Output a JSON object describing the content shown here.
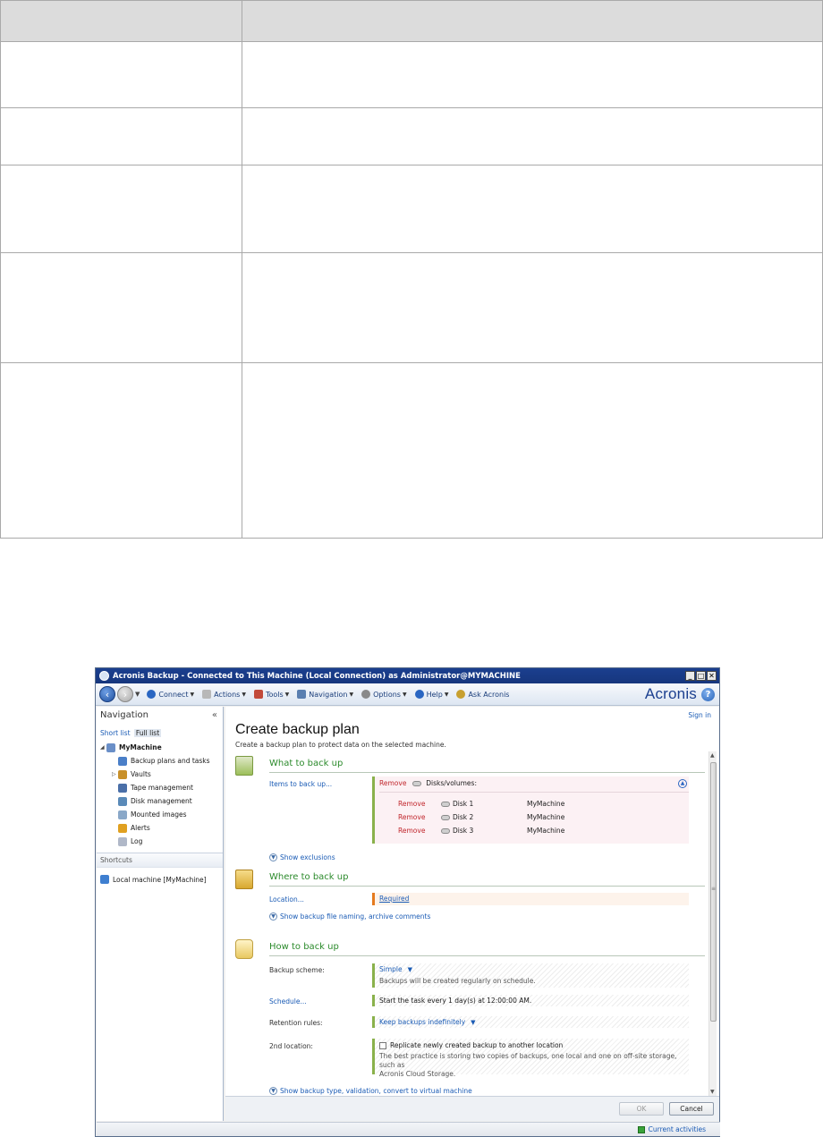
{
  "window": {
    "title": "Acronis Backup - Connected to This Machine (Local Connection) as Administrator@MYMACHINE",
    "brand": "Acronis"
  },
  "menubar": {
    "items": [
      {
        "label": "Connect",
        "icon": "connect-icon",
        "color": "#2a66c2"
      },
      {
        "label": "Actions",
        "icon": "actions-icon",
        "color": "#b8b8b8"
      },
      {
        "label": "Tools",
        "icon": "tools-icon",
        "color": "#c24a3a"
      },
      {
        "label": "Navigation",
        "icon": "navigation-icon",
        "color": "#5a7fb0"
      },
      {
        "label": "Options",
        "icon": "options-icon",
        "color": "#8a8a8a"
      },
      {
        "label": "Help",
        "icon": "help-icon",
        "color": "#2a66c2"
      },
      {
        "label": "Ask Acronis",
        "icon": "ask-acronis-icon",
        "color": "#c8a030"
      }
    ]
  },
  "sidebar": {
    "title": "Navigation",
    "short_list": "Short list",
    "full_list": "Full list",
    "root": "MyMachine",
    "items": [
      {
        "label": "Backup plans and tasks",
        "color": "#4a7fc8"
      },
      {
        "label": "Vaults",
        "color": "#c8902a"
      },
      {
        "label": "Tape management",
        "color": "#4a6fa8"
      },
      {
        "label": "Disk management",
        "color": "#5a8ab8"
      },
      {
        "label": "Mounted images",
        "color": "#8aa8c8"
      },
      {
        "label": "Alerts",
        "color": "#e0a020"
      },
      {
        "label": "Log",
        "color": "#b0b8c8"
      }
    ],
    "shortcuts_title": "Shortcuts",
    "shortcut": "Local machine [MyMachine]"
  },
  "main": {
    "sign_in": "Sign in",
    "title": "Create backup plan",
    "subtitle": "Create a backup plan to protect data on the selected machine.",
    "what": {
      "title": "What to back up",
      "items_label": "Items to back up...",
      "remove": "Remove",
      "disks_header": "Disks/volumes:",
      "disks": [
        {
          "name": "Disk 1",
          "machine": "MyMachine"
        },
        {
          "name": "Disk 2",
          "machine": "MyMachine"
        },
        {
          "name": "Disk 3",
          "machine": "MyMachine"
        }
      ],
      "show_exclusions": "Show exclusions"
    },
    "where": {
      "title": "Where to back up",
      "location_label": "Location...",
      "location_value": "Required",
      "show_naming": "Show backup file naming, archive comments"
    },
    "how": {
      "title": "How to back up",
      "scheme_label": "Backup scheme:",
      "scheme_value": "Simple",
      "scheme_desc": "Backups will be created regularly on schedule.",
      "schedule_label": "Schedule...",
      "schedule_value": "Start the task every 1 day(s) at 12:00:00 AM.",
      "retention_label": "Retention rules:",
      "retention_value": "Keep backups indefinitely",
      "second_label": "2nd location:",
      "second_check": "Replicate newly created backup to another location",
      "second_desc1": "The best practice is storing two copies of backups, one local and one on off-site storage, such as",
      "second_desc2": "Acronis Cloud Storage.",
      "show_type": "Show backup type, validation, convert to virtual machine"
    },
    "ok": "OK",
    "cancel": "Cancel"
  },
  "status": {
    "current_activities": "Current activities"
  }
}
